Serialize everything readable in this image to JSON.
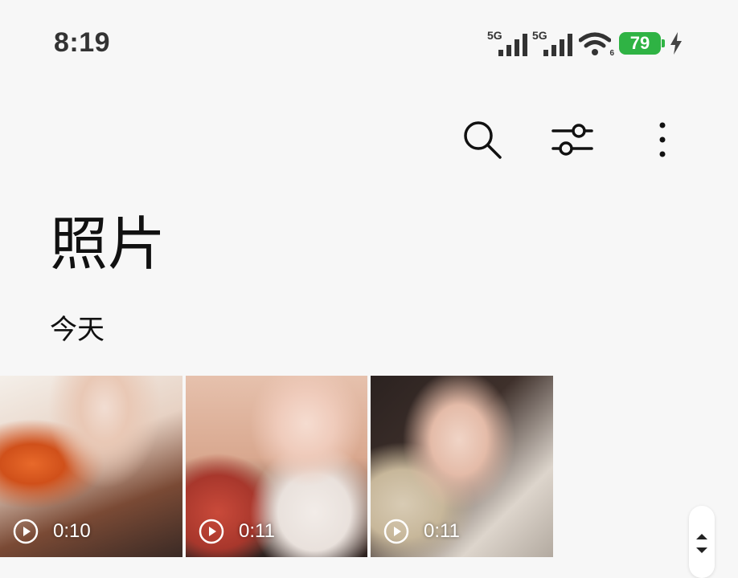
{
  "status_bar": {
    "time": "8:19",
    "signal_1_label": "5G",
    "signal_2_label": "5G",
    "wifi_sub": "6",
    "battery": "79",
    "battery_color": "#2fb344"
  },
  "toolbar": {
    "search_icon": "search-icon",
    "filter_icon": "sliders-icon",
    "more_icon": "more-vertical-icon"
  },
  "page": {
    "title": "照片",
    "section_date": "今天"
  },
  "thumbnails": [
    {
      "duration": "0:10",
      "type": "video"
    },
    {
      "duration": "0:11",
      "type": "video"
    },
    {
      "duration": "0:11",
      "type": "video"
    }
  ]
}
